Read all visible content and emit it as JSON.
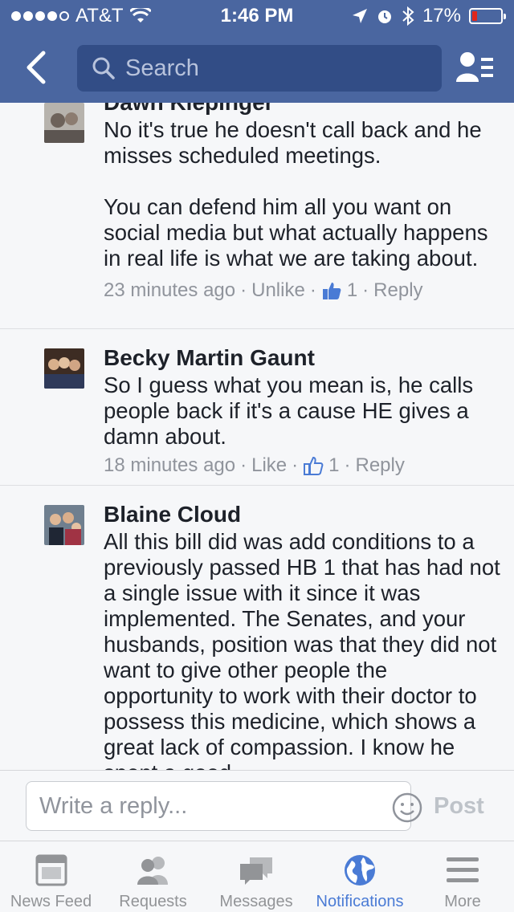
{
  "status_bar": {
    "carrier": "AT&T",
    "time": "1:46 PM",
    "battery": "17%",
    "battery_level": 0.17
  },
  "nav": {
    "search_placeholder": "Search"
  },
  "comments": [
    {
      "name": "Dawn Kiepinger",
      "text": "No it's true he doesn't call back and he misses scheduled meetings.\n\nYou can defend him all you want on social media but what actually happens in real life is what we are taking about.",
      "time": "23 minutes ago",
      "action": "Unlike",
      "likes": "1",
      "reply": "Reply"
    },
    {
      "name": "Becky Martin Gaunt",
      "text": "So I guess what you mean is, he calls people back if it's a cause HE gives a damn about.",
      "time": "18 minutes ago",
      "action": "Like",
      "likes": "1",
      "reply": "Reply"
    },
    {
      "name": "Blaine Cloud",
      "text": "All this bill did was add conditions to a previously passed HB 1 that has had not a single issue with it since it was implemented. The Senates, and your husbands, position was that they did not want to give other people the opportunity to work with their doctor to possess this medicine, which shows a great lack of compassion. I know he spent a good",
      "time": "",
      "action": "",
      "likes": "",
      "reply": ""
    }
  ],
  "reply_bar": {
    "placeholder": "Write a reply...",
    "post_label": "Post"
  },
  "tabs": [
    {
      "label": "News Feed",
      "icon": "news-feed-icon",
      "active": false
    },
    {
      "label": "Requests",
      "icon": "friend-requests-icon",
      "active": false
    },
    {
      "label": "Messages",
      "icon": "messages-icon",
      "active": false
    },
    {
      "label": "Notifications",
      "icon": "globe-icon",
      "active": true
    },
    {
      "label": "More",
      "icon": "menu-icon",
      "active": false
    }
  ],
  "colors": {
    "brand": "#4a66a0",
    "active_tab": "#4a7bd5",
    "like_blue": "#4a7bd5"
  }
}
